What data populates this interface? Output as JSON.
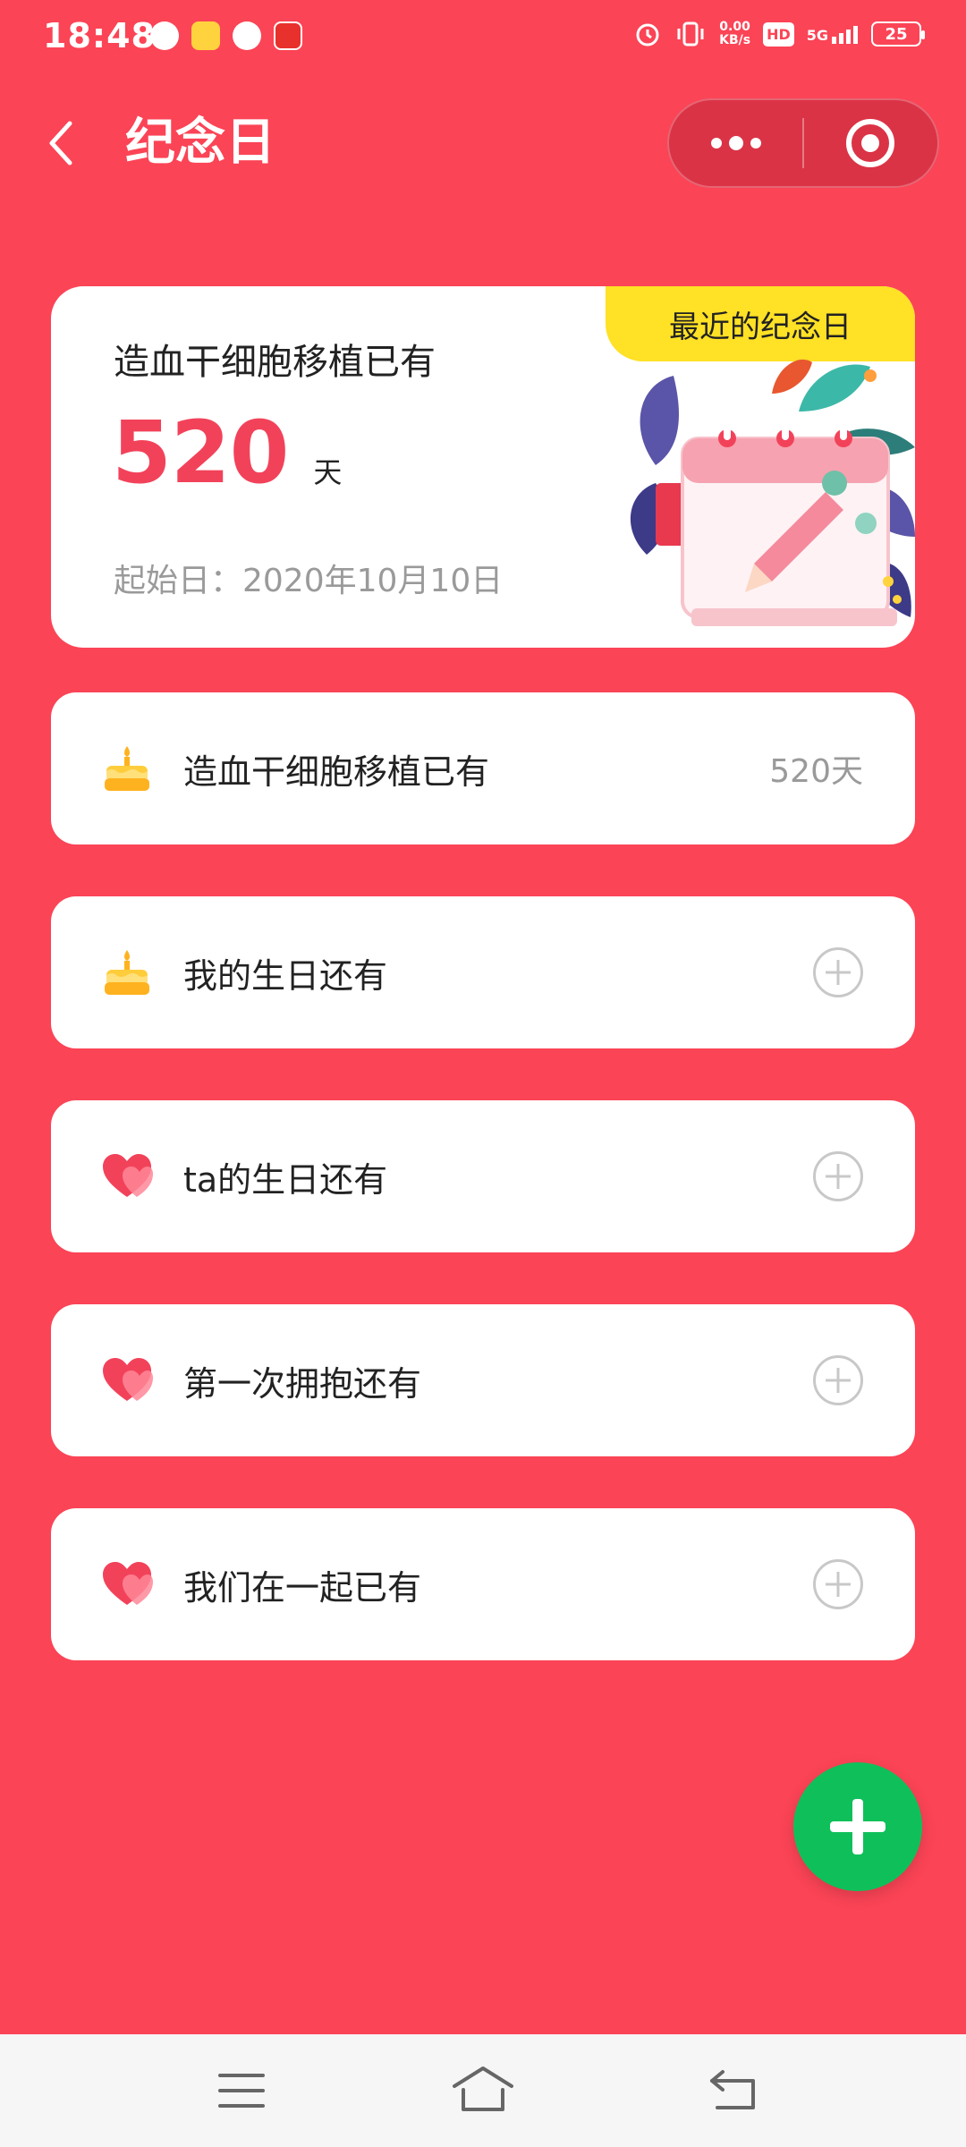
{
  "status_bar": {
    "time": "18:48",
    "net_speed_value": "0.00",
    "net_speed_unit": "KB/s",
    "hd": "HD",
    "signal": "5G",
    "battery": "25"
  },
  "header": {
    "title": "纪念日"
  },
  "featured": {
    "badge": "最近的纪念日",
    "title": "造血干细胞移植已有",
    "count": "520",
    "unit": "天",
    "start_date": "起始日：2020年10月10日"
  },
  "items": [
    {
      "label": "造血干细胞移植已有",
      "value": "520天",
      "icon": "cake-icon"
    },
    {
      "label": "我的生日还有",
      "value": "",
      "icon": "cake-icon"
    },
    {
      "label": "ta的生日还有",
      "value": "",
      "icon": "heart-icon"
    },
    {
      "label": "第一次拥抱还有",
      "value": "",
      "icon": "heart-icon"
    },
    {
      "label": "我们在一起已有",
      "value": "",
      "icon": "heart-icon"
    }
  ],
  "colors": {
    "background": "#fb4456",
    "accent_number": "#f2425a",
    "badge": "#ffe125",
    "fab": "#0fc05a"
  }
}
